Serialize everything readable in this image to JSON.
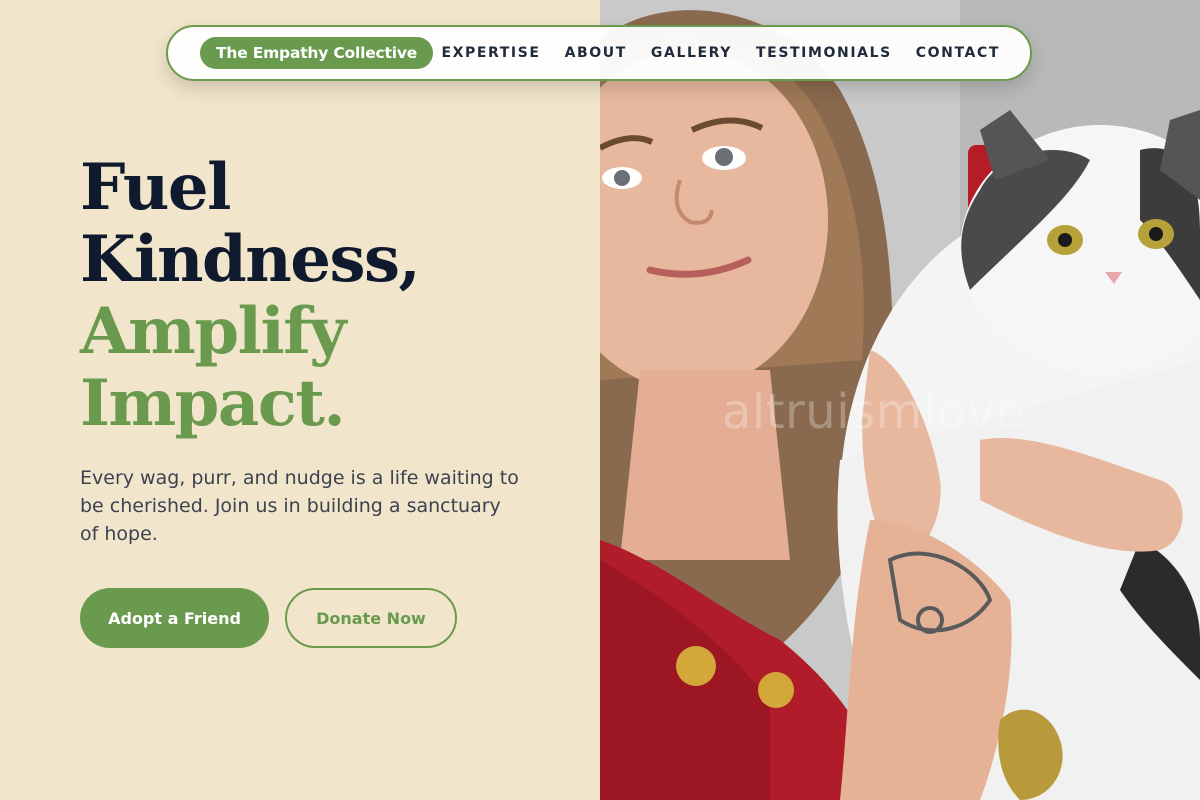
{
  "nav": {
    "brand": "The Empathy Collective",
    "links": [
      "EXPERTISE",
      "ABOUT",
      "GALLERY",
      "TESTIMONIALS",
      "CONTACT"
    ]
  },
  "hero": {
    "headline_line1": "Fuel",
    "headline_line2": "Kindness,",
    "headline_line3": "Amplify",
    "headline_line4": "Impact.",
    "subtext": "Every wag, purr, and nudge is a life waiting to be cherished. Join us in building a sanctuary of hope.",
    "primary_button": "Adopt a Friend",
    "secondary_button": "Donate Now"
  },
  "photo": {
    "watermark": "altruismlove",
    "subject": "woman-holding-cat"
  },
  "colors": {
    "accent_green": "#6a9a4e",
    "background_cream": "#f1e6cb",
    "heading_navy": "#0f1a2e",
    "sweater_red": "#b01c2a"
  }
}
